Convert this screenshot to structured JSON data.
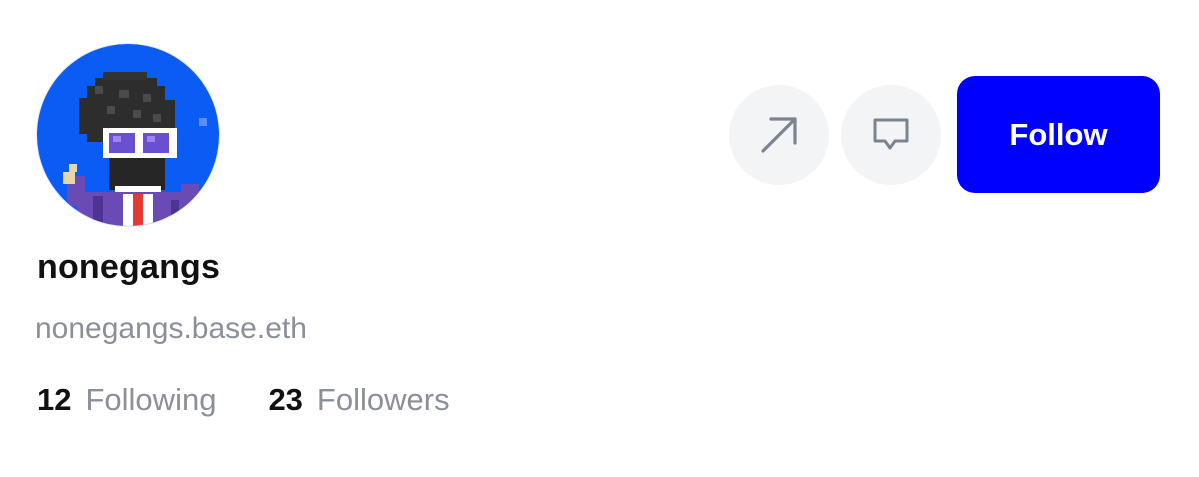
{
  "profile": {
    "display_name": "nonegangs",
    "handle": "nonegangs.base.eth",
    "avatar": {
      "icon": "pixel-art-avatar",
      "background_color": "#0a5cf5"
    }
  },
  "actions": {
    "share_icon": "arrow-up-right-icon",
    "message_icon": "chat-bubble-icon",
    "follow_label": "Follow",
    "follow_color": "#0000ff"
  },
  "stats": {
    "following": {
      "count": "12",
      "label": "Following"
    },
    "followers": {
      "count": "23",
      "label": "Followers"
    }
  }
}
